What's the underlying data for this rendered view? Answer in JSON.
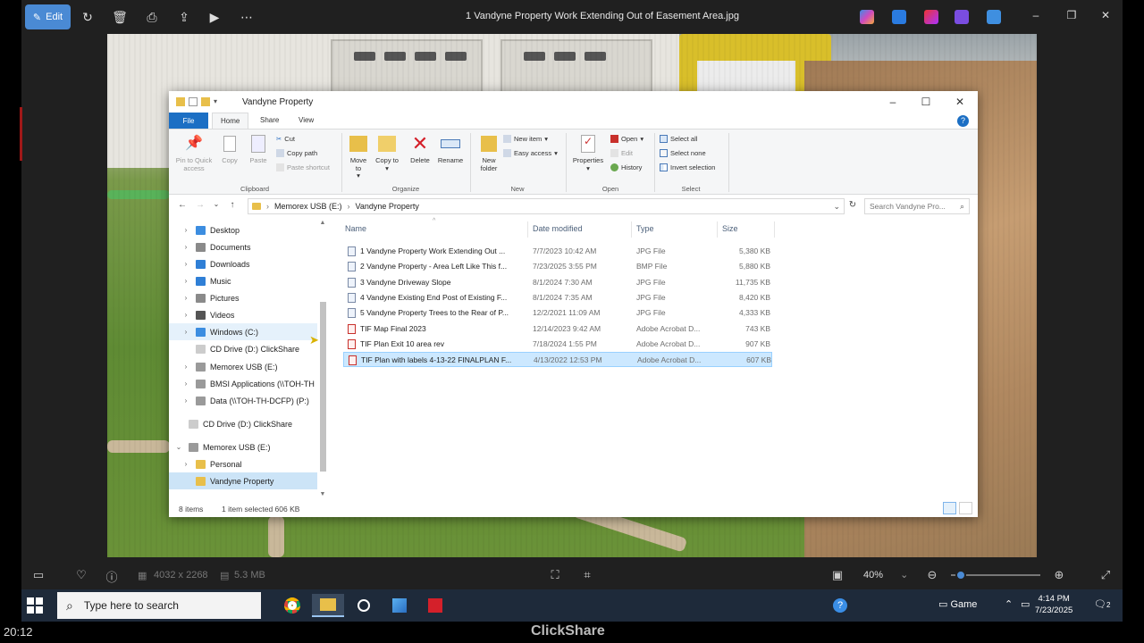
{
  "viewer": {
    "edit_label": "Edit",
    "title": "1 Vandyne Property Work Extending Out of Easement Area.jpg",
    "icons": [
      "rotate-icon",
      "delete-icon",
      "print-icon",
      "share-icon",
      "slideshow-icon",
      "more-icon"
    ],
    "bottom": {
      "dimensions": "4032 x 2268",
      "filesize": "5.3 MB",
      "zoom": "40%",
      "zoom_fraction": 0.05
    }
  },
  "explorer": {
    "title": "Vandyne Property",
    "tabs": {
      "file": "File",
      "home": "Home",
      "share": "Share",
      "view": "View"
    },
    "ribbon": {
      "clipboard": {
        "pin": "Pin to Quick access",
        "copy": "Copy",
        "paste": "Paste",
        "cut": "Cut",
        "copy_path": "Copy path",
        "paste_shortcut": "Paste shortcut",
        "label": "Clipboard"
      },
      "organize": {
        "move_to": "Move to",
        "copy_to": "Copy to",
        "delete": "Delete",
        "rename": "Rename",
        "label": "Organize"
      },
      "new": {
        "new_folder": "New folder",
        "new_item": "New item",
        "easy_access": "Easy access",
        "label": "New"
      },
      "open": {
        "properties": "Properties",
        "open": "Open",
        "edit": "Edit",
        "history": "History",
        "label": "Open"
      },
      "select": {
        "select_all": "Select all",
        "select_none": "Select none",
        "invert": "Invert selection",
        "label": "Select"
      }
    },
    "address": {
      "parts": [
        "Memorex USB (E:)",
        "Vandyne Property"
      ]
    },
    "search_placeholder": "Search Vandyne Pro...",
    "nav": [
      {
        "label": "Desktop",
        "color": "#3c8de0"
      },
      {
        "label": "Documents",
        "color": "#8a8a8a"
      },
      {
        "label": "Downloads",
        "color": "#2f7fd6"
      },
      {
        "label": "Music",
        "color": "#2f7fd6"
      },
      {
        "label": "Pictures",
        "color": "#8a8a8a"
      },
      {
        "label": "Videos",
        "color": "#555555"
      },
      {
        "label": "Windows  (C:)",
        "color": "#3c8de0"
      },
      {
        "label": "CD Drive (D:) ClickShare",
        "color": "#cccccc"
      },
      {
        "label": "Memorex USB (E:)",
        "color": "#9a9a9a"
      },
      {
        "label": "BMSI Applications (\\\\TOH-TH",
        "color": "#9a9a9a"
      },
      {
        "label": "Data (\\\\TOH-TH-DCFP) (P:)",
        "color": "#9a9a9a"
      },
      {
        "label": "CD Drive (D:) ClickShare",
        "color": "#cccccc"
      },
      {
        "label": "Memorex USB (E:)",
        "color": "#9a9a9a"
      },
      {
        "label": "Personal",
        "color": "#e8bf4a"
      },
      {
        "label": "Vandyne Property",
        "color": "#e8bf4a"
      }
    ],
    "columns": {
      "name": "Name",
      "date": "Date modified",
      "type": "Type",
      "size": "Size"
    },
    "files": [
      {
        "name": "1 Vandyne Property Work Extending Out ...",
        "date": "7/7/2023 10:42 AM",
        "type": "JPG File",
        "size": "5,380 KB",
        "kind": "img"
      },
      {
        "name": "2 Vandyne Property - Area Left Like This f...",
        "date": "7/23/2025 3:55 PM",
        "type": "BMP File",
        "size": "5,880 KB",
        "kind": "img"
      },
      {
        "name": "3 Vandyne Driveway Slope",
        "date": "8/1/2024 7:30 AM",
        "type": "JPG File",
        "size": "11,735 KB",
        "kind": "img"
      },
      {
        "name": "4 Vandyne Existing End Post of Existing F...",
        "date": "8/1/2024 7:35 AM",
        "type": "JPG File",
        "size": "8,420 KB",
        "kind": "img"
      },
      {
        "name": "5 Vandyne Property Trees to the Rear of P...",
        "date": "12/2/2021 11:09 AM",
        "type": "JPG File",
        "size": "4,333 KB",
        "kind": "img"
      },
      {
        "name": "TIF Map Final 2023",
        "date": "12/14/2023 9:42 AM",
        "type": "Adobe Acrobat D...",
        "size": "743 KB",
        "kind": "pdf"
      },
      {
        "name": "TIF Plan Exit 10 area rev",
        "date": "7/18/2024 1:55 PM",
        "type": "Adobe Acrobat D...",
        "size": "907 KB",
        "kind": "pdf"
      },
      {
        "name": "TIF Plan with labels 4-13-22 FINALPLAN F...",
        "date": "4/13/2022 12:53 PM",
        "type": "Adobe Acrobat D...",
        "size": "607 KB",
        "kind": "pdf"
      }
    ],
    "status": {
      "count": "8 items",
      "selected": "1 item selected  606 KB"
    }
  },
  "taskbar": {
    "search_placeholder": "Type here to search",
    "weather": "Game",
    "time": "4:14 PM",
    "date": "7/23/2025",
    "notif_count": "2"
  },
  "outer": {
    "time": "20:12",
    "brand": "ClickShare"
  }
}
